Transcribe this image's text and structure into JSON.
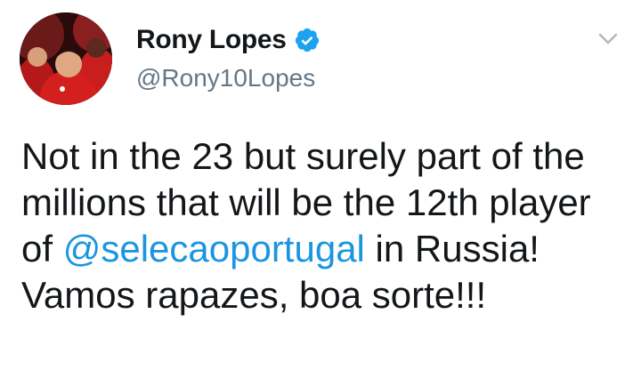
{
  "tweet": {
    "display_name": "Rony Lopes",
    "handle": "@Rony10Lopes",
    "verified": true,
    "text_part1": "Not in the 23 but surely part of the millions that will be the 12th player of ",
    "mention": "@selecaoportugal",
    "text_part2": " in Russia! Vamos rapazes, boa sorte!!!"
  },
  "icons": {
    "verified": "verified-badge-icon",
    "menu": "chevron-down-icon"
  },
  "colors": {
    "link": "#1b95e0",
    "verified": "#1da1f2",
    "text": "#14171a",
    "secondary": "#657786"
  }
}
